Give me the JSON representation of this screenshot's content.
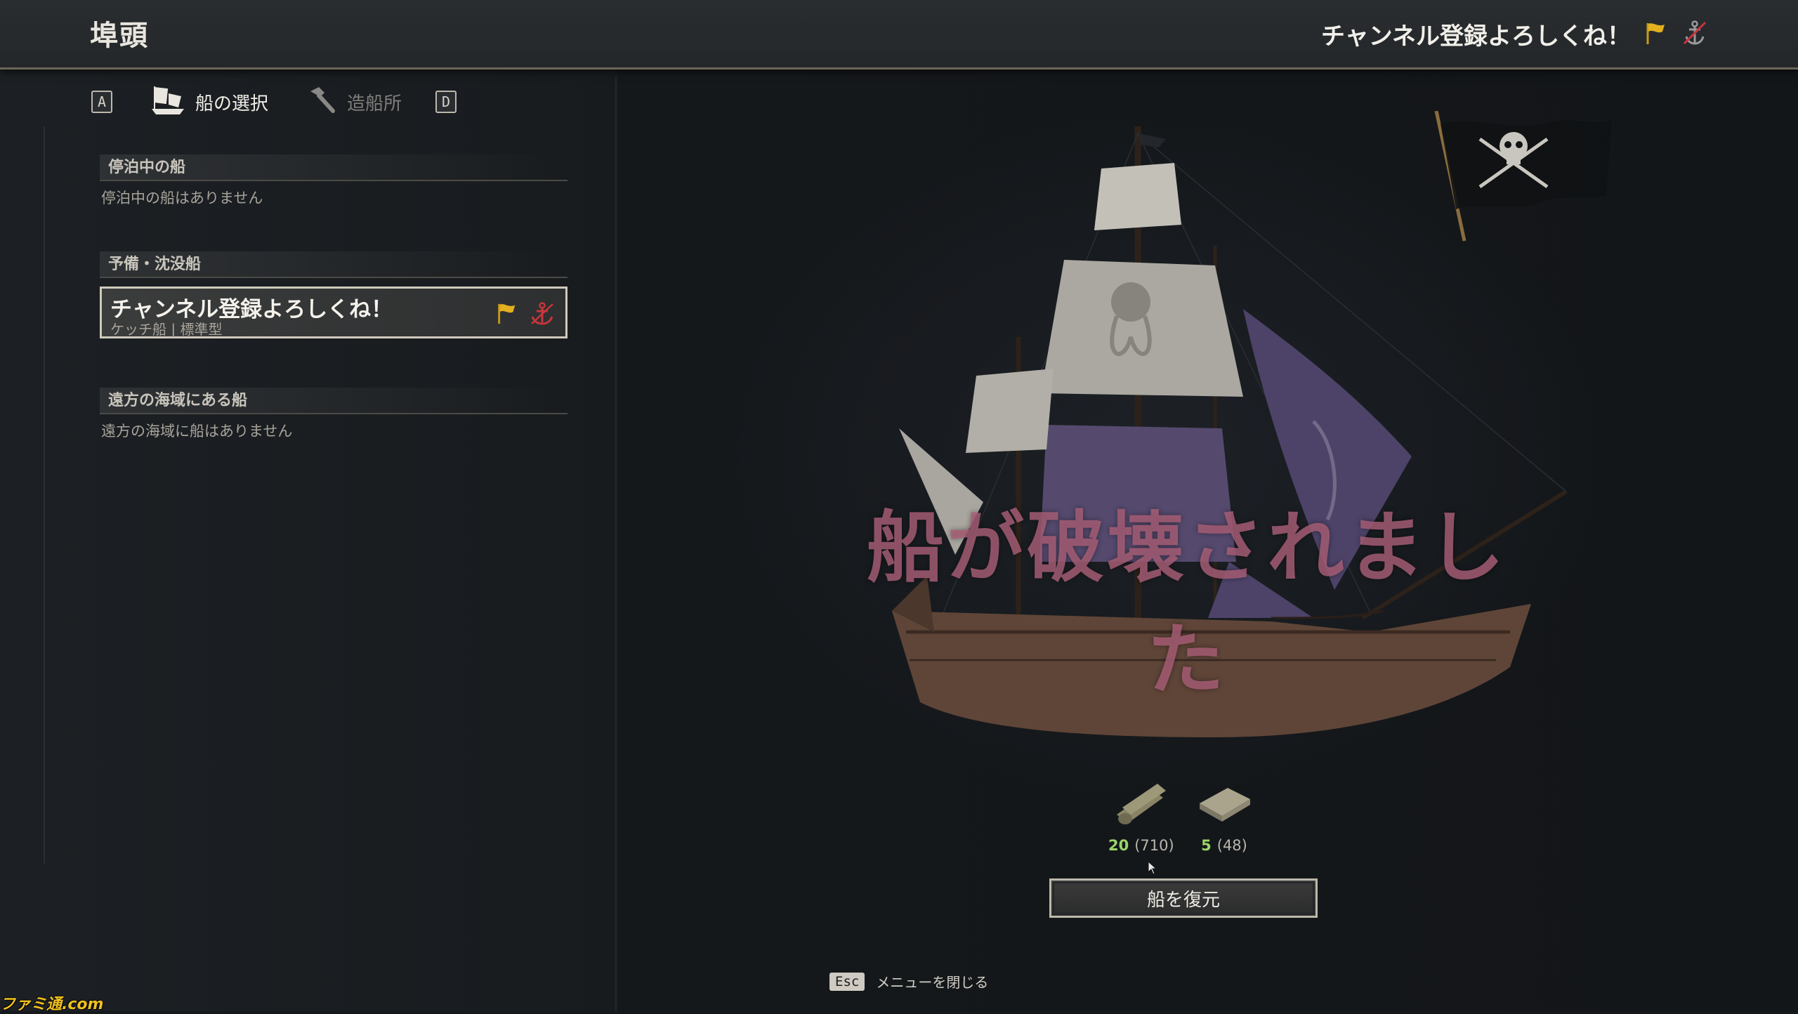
{
  "header": {
    "title": "埠頭",
    "ship_name": "チャンネル登録よろしくね！",
    "flag_icon": "yellow-flag-icon",
    "anchor_icon": "anchor-crossed-icon"
  },
  "tabs": {
    "prev_key": "A",
    "next_key": "D",
    "items": [
      {
        "label": "船の選択",
        "icon": "ship-select-icon",
        "active": true
      },
      {
        "label": "造船所",
        "icon": "hammer-icon",
        "active": false
      }
    ]
  },
  "sections": {
    "docked": {
      "heading": "停泊中の船",
      "empty": "停泊中の船はありません"
    },
    "reserve": {
      "heading": "予備・沈没船",
      "ship": {
        "name": "チャンネル登録よろしくね！",
        "type": "ケッチ船 | 標準型"
      }
    },
    "distant": {
      "heading": "遠方の海域にある船",
      "empty": "遠方の海域に船はありません"
    }
  },
  "status": {
    "destroyed": "船が破壊されました"
  },
  "resources": [
    {
      "icon": "wood-icon",
      "have": "20",
      "total": "(710)"
    },
    {
      "icon": "cloth-icon",
      "have": "5",
      "total": "(48)"
    }
  ],
  "restore_button": "船を復元",
  "footer": {
    "key": "Esc",
    "label": "メニューを閉じる"
  },
  "watermark": "ファミ通.com",
  "colors": {
    "resource_have": "#9bd46a",
    "destroyed_text": "#aa5f78",
    "flag": "#e4b020",
    "anchor": "#c8353a"
  }
}
